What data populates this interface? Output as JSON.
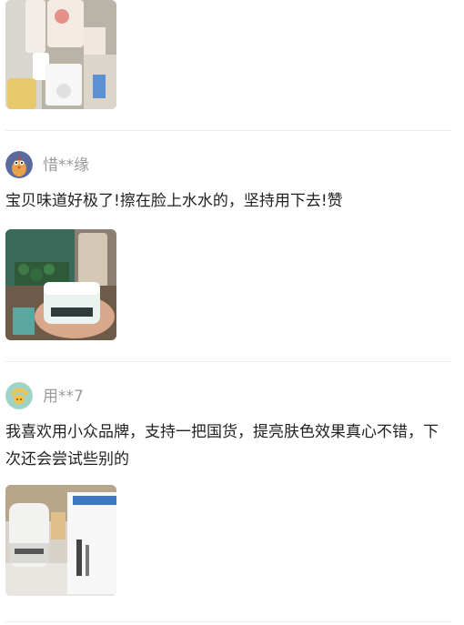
{
  "reviews": [
    {
      "username": "",
      "text": ""
    },
    {
      "username": "惜**缘",
      "text": "宝贝味道好极了!擦在脸上水水的，坚持用下去!赞",
      "avatar_icon": "bird-avatar-icon"
    },
    {
      "username": "用**7",
      "text": "我喜欢用小众品牌，支持一把国货，提亮肤色效果真心不错，下次还会尝试些别的",
      "avatar_icon": "paw-avatar-icon"
    }
  ],
  "colors": {
    "username": "#9a9a9a",
    "text": "#222222",
    "divider": "#ececec",
    "avatar1_bg": "#5b6a9e",
    "avatar2_bg": "#9fd3c6"
  }
}
